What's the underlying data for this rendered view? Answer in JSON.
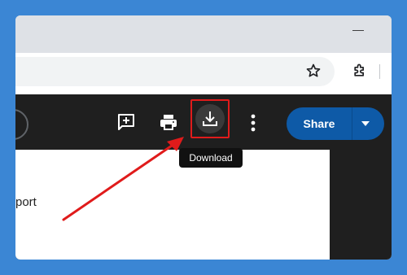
{
  "toolbar": {
    "share_label": "Share",
    "tooltip": "Download"
  },
  "document": {
    "visible_text": "port"
  },
  "icons": [
    "minimize-icon",
    "star-icon",
    "extension-icon",
    "comment-icon",
    "print-icon",
    "download-icon",
    "more-icon",
    "chevron-down-icon"
  ],
  "colors": {
    "background": "#3b86d4",
    "docs_bar": "#1f1f1f",
    "share_button": "#0e5aa7",
    "highlight": "#e01b1b"
  }
}
